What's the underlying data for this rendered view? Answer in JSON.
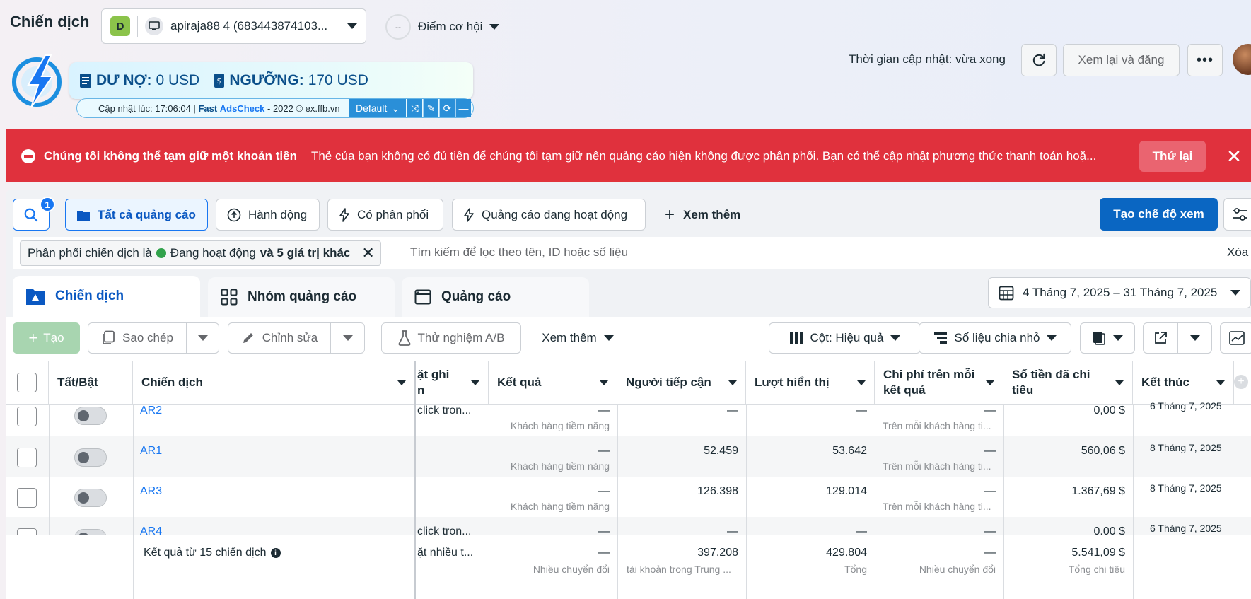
{
  "header": {
    "title": "Chiến dịch",
    "account": {
      "badge": "D",
      "name": "apiraja88 4 (683443874103..."
    },
    "opportunity": {
      "score": "--",
      "label": "Điểm cơ hội"
    },
    "update_time": "Thời gian cập nhật: vừa xong",
    "review_label": "Xem lại và đăng",
    "more_label": "•••"
  },
  "fac": {
    "debt_label": "DƯ NỢ:",
    "debt_value": "0 USD",
    "threshold_label": "NGƯỠNG:",
    "threshold_value": "170 USD",
    "bar_prefix": "Cập nhật lúc: 17:06:04 |",
    "bar_fast": "Fast",
    "bar_ads": "AdsCheck",
    "bar_suffix": "- 2022 © ex.ffb.vn",
    "preset": "Default"
  },
  "alert": {
    "title": "Chúng tôi không thể tạm giữ một khoản tiền",
    "message": "Thẻ của bạn không có đủ tiền để chúng tôi tạm giữ nên quảng cáo hiện không được phân phối. Bạn có thể cập nhật phương thức thanh toán hoặ...",
    "retry": "Thử lại",
    "close": "✕"
  },
  "filters": {
    "search_badge": "1",
    "chips": [
      "Tất cả quảng cáo",
      "Hành động",
      "Có phân phối",
      "Quảng cáo đang hoạt động"
    ],
    "more": "Xem thêm",
    "create_view": "Tạo chế độ xem",
    "filter_chip_prefix": "Phân phối chiến dịch là",
    "filter_chip_value": "Đang hoạt động",
    "filter_chip_more": "và 5 giá trị khác",
    "search_placeholder": "Tìm kiếm để lọc theo tên, ID hoặc số liệu",
    "clear": "Xóa"
  },
  "level_tabs": [
    "Chiến dịch",
    "Nhóm quảng cáo",
    "Quảng cáo"
  ],
  "date_range": "4 Tháng 7, 2025 – 31 Tháng 7, 2025",
  "toolbar": {
    "create": "Tạo",
    "copy": "Sao chép",
    "edit": "Chỉnh sửa",
    "ab_test": "Thử nghiệm A/B",
    "more": "Xem thêm",
    "columns": "Cột: Hiệu quả",
    "breakdown": "Số liệu chia nhỏ"
  },
  "table": {
    "headers": {
      "toggle": "Tất/Bật",
      "campaign": "Chiến dịch",
      "bid": "ặt ghi",
      "bid2": "n",
      "result": "Kết quả",
      "reach": "Người tiếp cận",
      "impressions": "Lượt hiển thị",
      "cpr1": "Chi phí trên mỗi",
      "cpr2": "kết quả",
      "spent1": "Số tiền đã chi",
      "spent2": "tiêu",
      "end": "Kết thúc"
    },
    "rows": [
      {
        "name": "AR2",
        "bid": "click tron...",
        "result": "—",
        "result_sub": "Khách hàng tiềm năng",
        "reach": "—",
        "impressions": "—",
        "cpr": "—",
        "cpr_sub": "Trên mỗi khách hàng ti...",
        "spent": "0,00 $",
        "end": "6 Tháng 7, 2025"
      },
      {
        "name": "AR1",
        "bid": "",
        "result": "—",
        "result_sub": "Khách hàng tiềm năng",
        "reach": "52.459",
        "impressions": "53.642",
        "cpr": "—",
        "cpr_sub": "Trên mỗi khách hàng ti...",
        "spent": "560,06 $",
        "end": "8 Tháng 7, 2025"
      },
      {
        "name": "AR3",
        "bid": "",
        "result": "—",
        "result_sub": "Khách hàng tiềm năng",
        "reach": "126.398",
        "impressions": "129.014",
        "cpr": "—",
        "cpr_sub": "Trên mỗi khách hàng ti...",
        "spent": "1.367,69 $",
        "end": "8 Tháng 7, 2025"
      },
      {
        "name": "AR4",
        "bid": "click tron...",
        "result": "—",
        "result_sub": "",
        "reach": "—",
        "impressions": "—",
        "cpr": "—",
        "cpr_sub": "",
        "spent": "0,00 $",
        "end": "6 Tháng 7, 2025"
      }
    ],
    "footer": {
      "label": "Kết quả từ 15 chiến dịch",
      "bid": "ặt nhiều t...",
      "result": "—",
      "result_sub": "Nhiều chuyển đổi",
      "reach": "397.208",
      "reach_sub": "tài khoản trong Trung ...",
      "impressions": "429.804",
      "impressions_sub": "Tổng",
      "cpr": "—",
      "cpr_sub": "Nhiều chuyển đổi",
      "spent": "5.541,09 $",
      "spent_sub": "Tổng chi tiêu"
    }
  }
}
